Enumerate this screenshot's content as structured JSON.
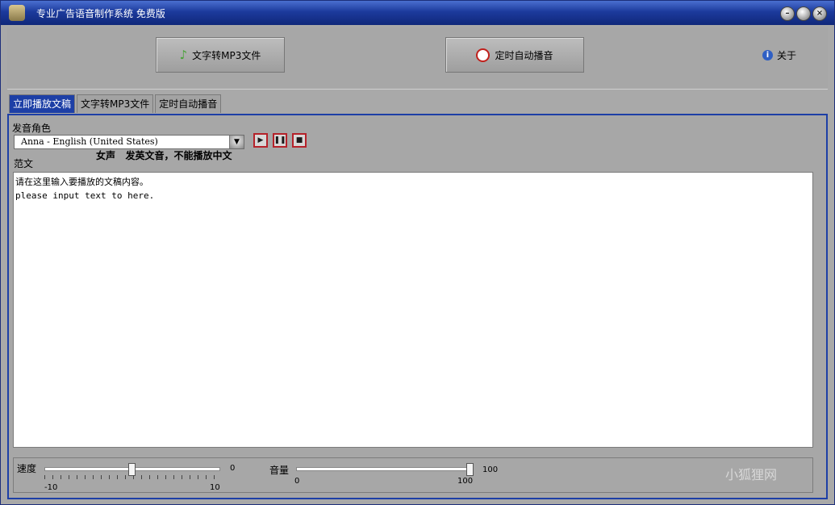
{
  "window": {
    "title": "专业广告语音制作系统 免费版"
  },
  "toolbar": {
    "mp3_label": "文字转MP3文件",
    "timer_label": "定时自动播音",
    "about_label": "关于"
  },
  "tabs": [
    {
      "label": "立即播放文稿",
      "active": true
    },
    {
      "label": "文字转MP3文件",
      "active": false
    },
    {
      "label": "定时自动播音",
      "active": false
    }
  ],
  "voice": {
    "label": "发音角色",
    "selected": "Anna - English (United States)",
    "note": "女声   发英文音，不能播放中文"
  },
  "text": {
    "label": "范文",
    "content": "请在这里输入要播放的文稿内容。\nplease input text to here."
  },
  "speed": {
    "label": "速度",
    "value": "0",
    "min": "-10",
    "max": "10",
    "level": 0.5
  },
  "volume": {
    "label": "音量",
    "value": "100",
    "min": "0",
    "max": "100",
    "level": 1.0
  },
  "watermark": "小狐狸网"
}
